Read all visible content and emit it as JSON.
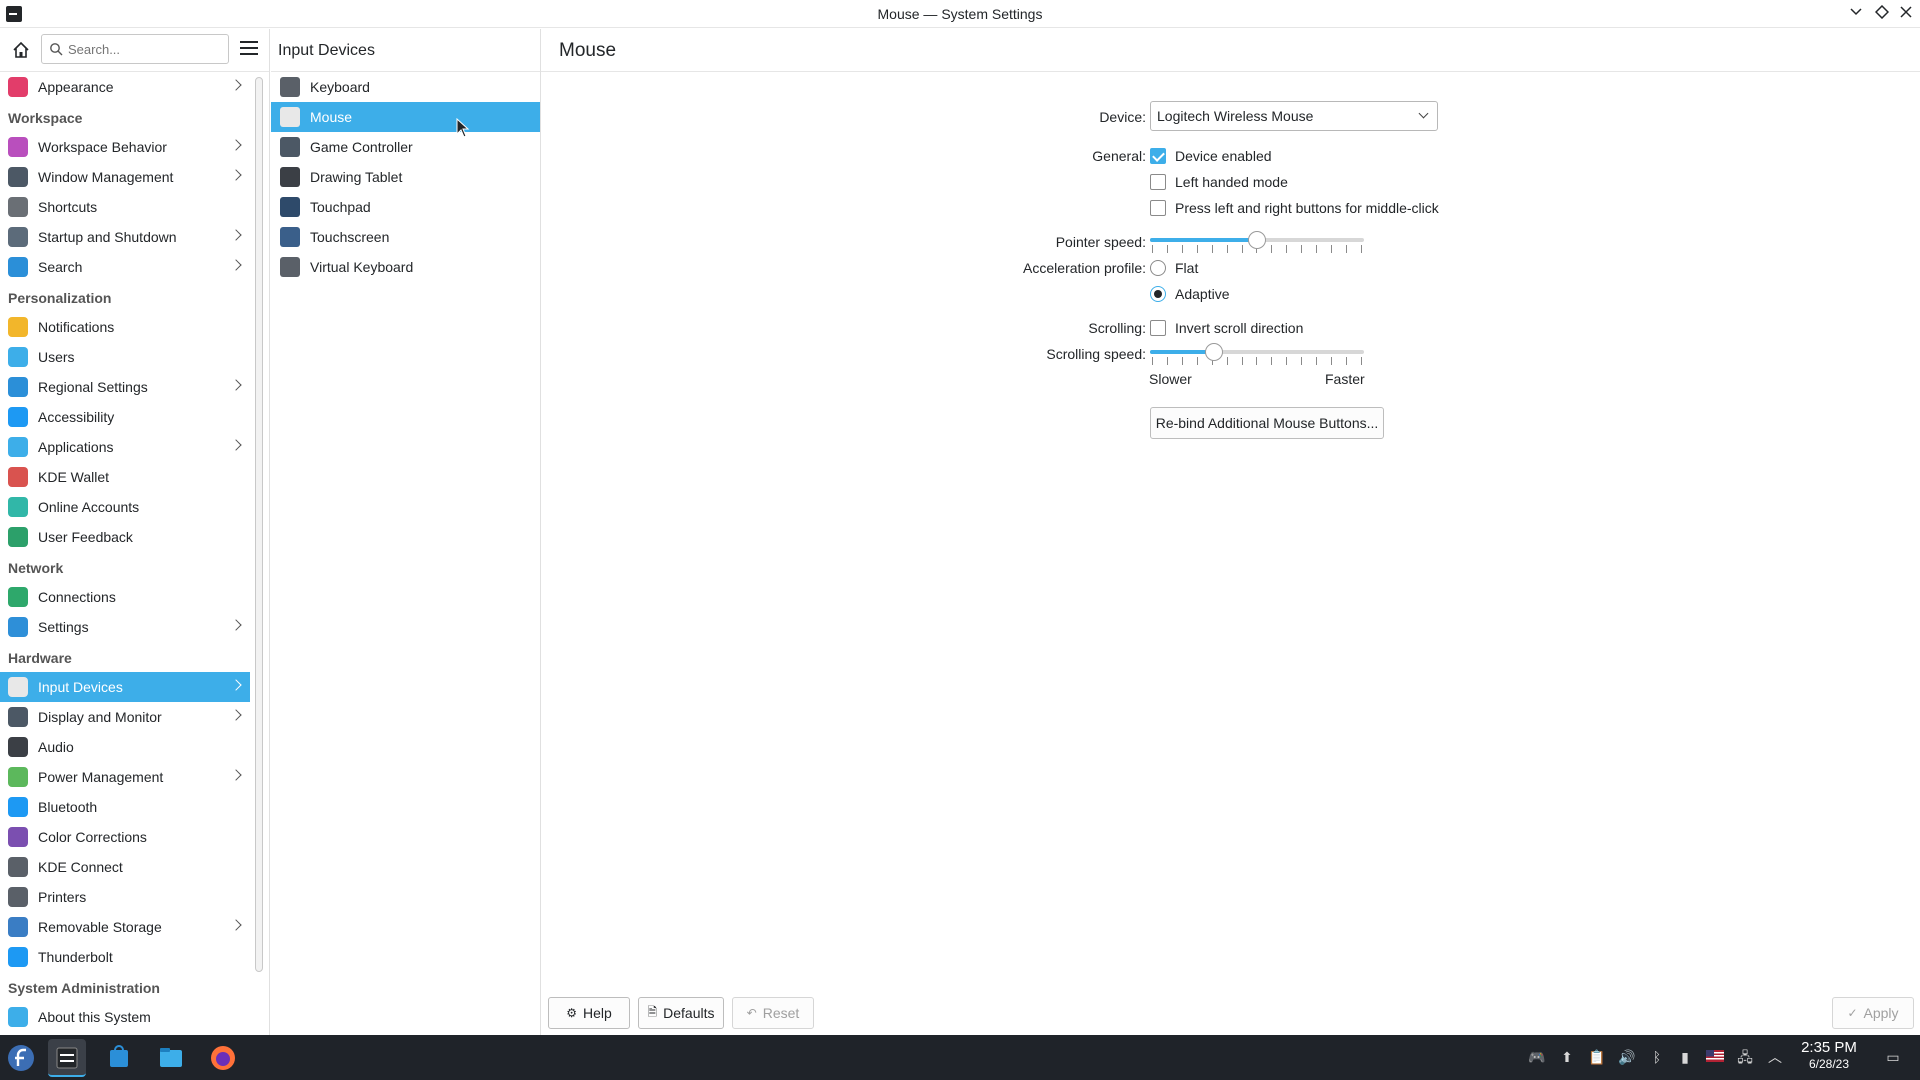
{
  "window": {
    "title": "Mouse — System Settings",
    "minimize_icon": "chevron-down",
    "maximize_icon": "diamond",
    "close_icon": "x"
  },
  "sidebar": {
    "search_placeholder": "Search...",
    "items": [
      {
        "label": "Appearance",
        "icon_color": "#e23d6a",
        "arrow": true
      },
      {
        "section": "Workspace"
      },
      {
        "label": "Workspace Behavior",
        "icon_color": "#b94fbd",
        "arrow": true
      },
      {
        "label": "Window Management",
        "icon_color": "#4c5865",
        "arrow": true
      },
      {
        "label": "Shortcuts",
        "icon_color": "#6a6f75",
        "arrow": false
      },
      {
        "label": "Startup and Shutdown",
        "icon_color": "#5c6b7a",
        "arrow": true
      },
      {
        "label": "Search",
        "icon_color": "#2b8fd8",
        "arrow": true
      },
      {
        "section": "Personalization"
      },
      {
        "label": "Notifications",
        "icon_color": "#f2b62b",
        "arrow": false
      },
      {
        "label": "Users",
        "icon_color": "#3daee9",
        "arrow": false
      },
      {
        "label": "Regional Settings",
        "icon_color": "#2b8fd8",
        "arrow": true
      },
      {
        "label": "Accessibility",
        "icon_color": "#1d99f3",
        "arrow": false
      },
      {
        "label": "Applications",
        "icon_color": "#3daee9",
        "arrow": true
      },
      {
        "label": "KDE Wallet",
        "icon_color": "#d9534f",
        "arrow": false
      },
      {
        "label": "Online Accounts",
        "icon_color": "#31b7a8",
        "arrow": false
      },
      {
        "label": "User Feedback",
        "icon_color": "#2ca06a",
        "arrow": false
      },
      {
        "section": "Network"
      },
      {
        "label": "Connections",
        "icon_color": "#2ea86b",
        "arrow": false
      },
      {
        "label": "Settings",
        "icon_color": "#2e8fd8",
        "arrow": true
      },
      {
        "section": "Hardware"
      },
      {
        "label": "Input Devices",
        "icon_color": "#e8e8e8",
        "arrow": true,
        "selected": true
      },
      {
        "label": "Display and Monitor",
        "icon_color": "#4c5865",
        "arrow": true
      },
      {
        "label": "Audio",
        "icon_color": "#3b3f45",
        "arrow": false
      },
      {
        "label": "Power Management",
        "icon_color": "#5cb85c",
        "arrow": true
      },
      {
        "label": "Bluetooth",
        "icon_color": "#1d99f3",
        "arrow": false
      },
      {
        "label": "Color Corrections",
        "icon_color": "#7b4fb0",
        "arrow": false
      },
      {
        "label": "KDE Connect",
        "icon_color": "#5a6068",
        "arrow": false
      },
      {
        "label": "Printers",
        "icon_color": "#5a6068",
        "arrow": false
      },
      {
        "label": "Removable Storage",
        "icon_color": "#3a7dc4",
        "arrow": true
      },
      {
        "label": "Thunderbolt",
        "icon_color": "#1d99f3",
        "arrow": false
      },
      {
        "section": "System Administration"
      },
      {
        "label": "About this System",
        "icon_color": "#3daee9",
        "arrow": false
      }
    ]
  },
  "input_devices": {
    "header": "Input Devices",
    "items": [
      {
        "label": "Keyboard",
        "icon_color": "#5a6068"
      },
      {
        "label": "Mouse",
        "icon_color": "#e8e8e8",
        "selected": true
      },
      {
        "label": "Game Controller",
        "icon_color": "#4c5865"
      },
      {
        "label": "Drawing Tablet",
        "icon_color": "#3b3f45"
      },
      {
        "label": "Touchpad",
        "icon_color": "#2e4a6a"
      },
      {
        "label": "Touchscreen",
        "icon_color": "#3a5f8a"
      },
      {
        "label": "Virtual Keyboard",
        "icon_color": "#5a6068"
      }
    ]
  },
  "mouse": {
    "header": "Mouse",
    "device_label": "Device:",
    "device_value": "Logitech Wireless Mouse",
    "general_label": "General:",
    "general_options": [
      {
        "label": "Device enabled",
        "checked": true
      },
      {
        "label": "Left handed mode",
        "checked": false
      },
      {
        "label": "Press left and right buttons for middle-click",
        "checked": false
      }
    ],
    "pointer_speed_label": "Pointer speed:",
    "pointer_speed_fraction": 0.5,
    "accel_label": "Acceleration profile:",
    "accel_options": [
      {
        "label": "Flat",
        "selected": false
      },
      {
        "label": "Adaptive",
        "selected": true
      }
    ],
    "scrolling_label": "Scrolling:",
    "invert_scroll": {
      "label": "Invert scroll direction",
      "checked": false
    },
    "scrolling_speed_label": "Scrolling speed:",
    "scrolling_speed_fraction": 0.3,
    "slower_label": "Slower",
    "faster_label": "Faster",
    "rebind_button": "Re-bind Additional Mouse Buttons..."
  },
  "footer": {
    "help": "Help",
    "defaults": "Defaults",
    "reset": "Reset",
    "apply": "Apply"
  },
  "taskbar": {
    "time": "2:35 PM",
    "date": "6/28/23",
    "apps": [
      "fedora-launcher-icon",
      "system-settings-icon",
      "discover-store-icon",
      "dolphin-files-icon",
      "firefox-icon"
    ]
  }
}
